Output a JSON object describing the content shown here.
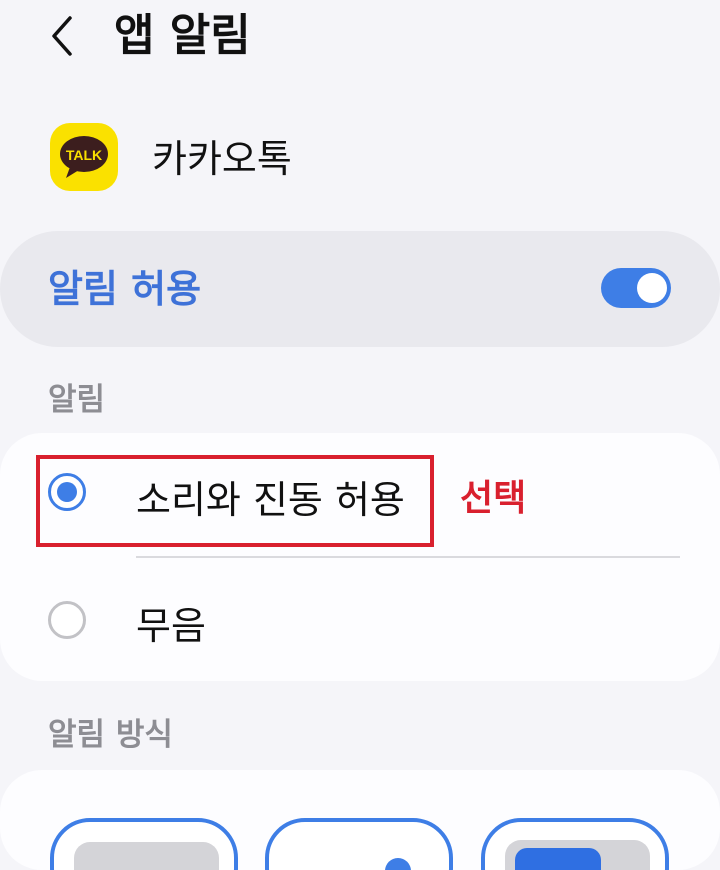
{
  "header": {
    "back_icon": "chevron-left-icon",
    "title": "앱 알림"
  },
  "app": {
    "icon": "kakaotalk-app-icon",
    "icon_text": "TALK",
    "icon_color": "#fae100",
    "name": "카카오톡"
  },
  "allow_notifications": {
    "label": "알림 허용",
    "enabled": true,
    "accent_color": "#3e7ee6"
  },
  "notifications": {
    "section_label": "알림",
    "options": [
      {
        "label": "소리와 진동 허용",
        "selected": true
      },
      {
        "label": "무음",
        "selected": false
      }
    ]
  },
  "annotation": {
    "text": "선택",
    "color": "#d9202e"
  },
  "notification_style": {
    "section_label": "알림 방식"
  }
}
